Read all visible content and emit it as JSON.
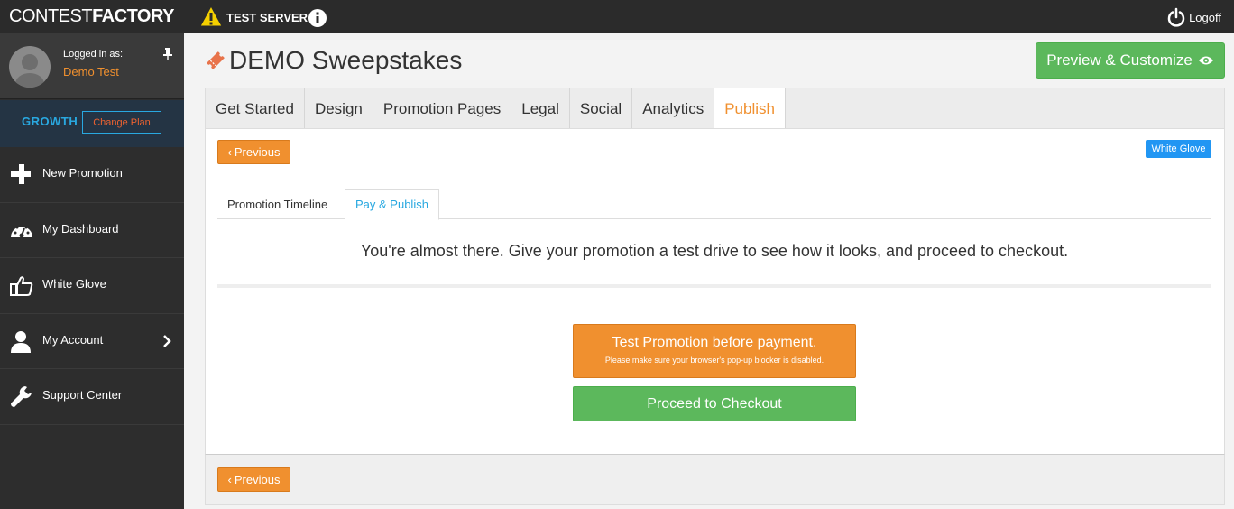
{
  "topbar": {
    "logo_light": "CONTEST",
    "logo_bold": "FACTORY",
    "server_label": "TEST SERVER",
    "logoff_label": "Logoff",
    "warning_icon": "warning-triangle-icon",
    "info_icon": "info-circle-icon",
    "power_icon": "power-icon"
  },
  "sidebar": {
    "logged_in_label": "Logged in as:",
    "user_name": "Demo Test",
    "plan_name": "GROWTH",
    "change_plan_label": "Change Plan",
    "items": [
      {
        "label": "New Promotion",
        "icon": "plus-icon"
      },
      {
        "label": "My Dashboard",
        "icon": "dashboard-icon"
      },
      {
        "label": "White Glove",
        "icon": "thumbs-up-icon"
      },
      {
        "label": "My Account",
        "icon": "user-icon"
      },
      {
        "label": "Support Center",
        "icon": "wrench-icon"
      }
    ]
  },
  "header": {
    "title": "DEMO Sweepstakes",
    "preview_label": "Preview & Customize"
  },
  "tabs": [
    {
      "label": "Get Started"
    },
    {
      "label": "Design"
    },
    {
      "label": "Promotion Pages"
    },
    {
      "label": "Legal"
    },
    {
      "label": "Social"
    },
    {
      "label": "Analytics"
    },
    {
      "label": "Publish",
      "active": true
    }
  ],
  "panel": {
    "previous_label": "Previous",
    "white_glove_label": "White Glove",
    "subtabs": [
      {
        "label": "Promotion Timeline"
      },
      {
        "label": "Pay & Publish",
        "active": true
      }
    ],
    "intro_text": "You're almost there. Give your promotion a test drive to see how it looks, and proceed to checkout.",
    "test_button_title": "Test Promotion before payment.",
    "test_button_note": "Please make sure your browser's pop-up blocker is disabled.",
    "checkout_label": "Proceed to Checkout"
  },
  "colors": {
    "accent_orange": "#f0902f",
    "accent_green": "#5cb85c",
    "accent_blue": "#29a8e0",
    "topbar_bg": "#2b2b2b",
    "sidebar_bg": "#2d2d2d"
  }
}
